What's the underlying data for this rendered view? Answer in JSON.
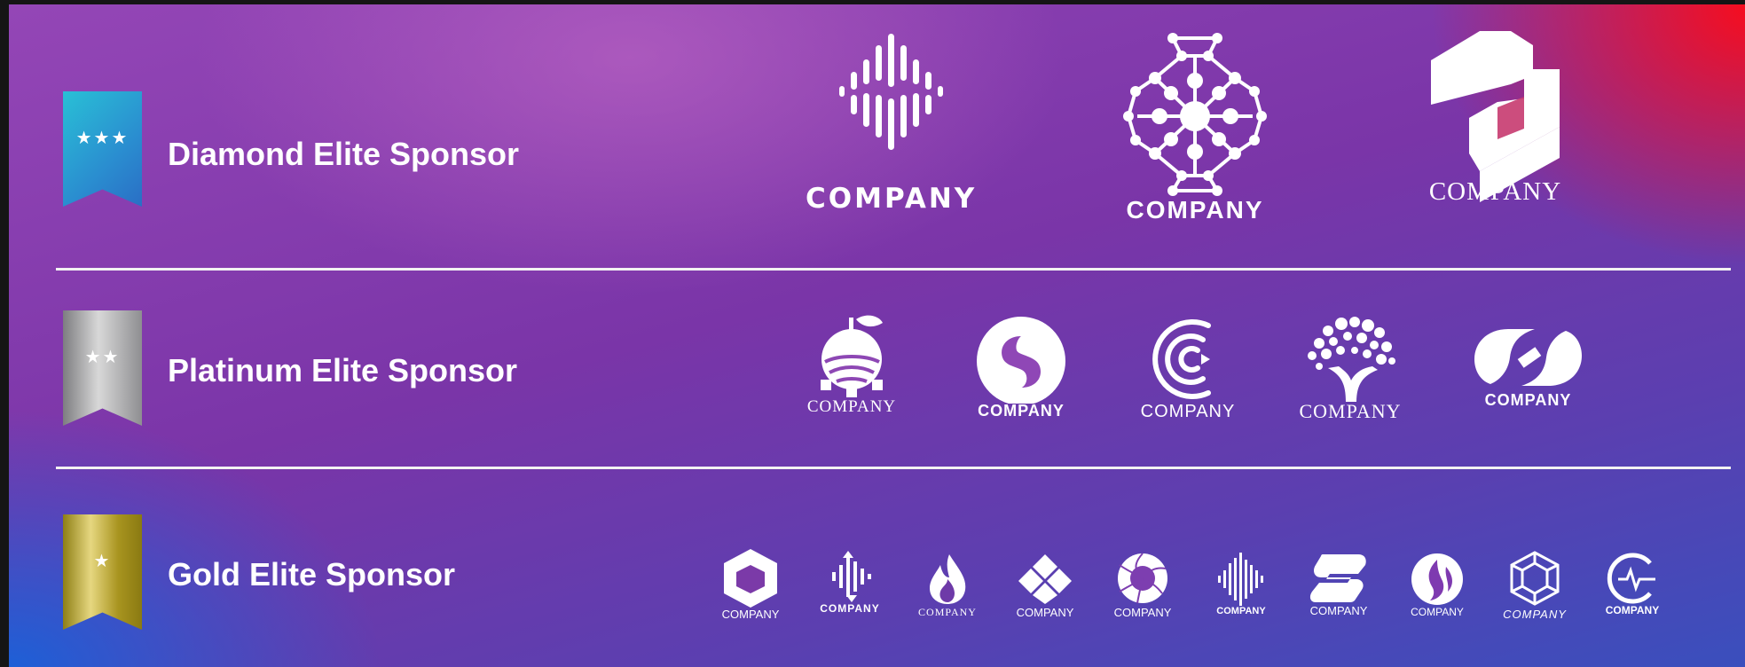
{
  "tiers": [
    {
      "title": "Diamond Elite Sponsor",
      "stars": "★★★",
      "logos": [
        {
          "icon": "sound-wave-diamond-icon",
          "name": "COMPANY"
        },
        {
          "icon": "molecule-network-icon",
          "name": "COMPANY"
        },
        {
          "icon": "hexagon-s-icon",
          "name": "COMPANY"
        }
      ]
    },
    {
      "title": "Platinum Elite Sponsor",
      "stars": "★★",
      "logos": [
        {
          "icon": "fruit-gear-icon",
          "name": "COMPANY"
        },
        {
          "icon": "circle-swirl-icon",
          "name": "COMPANY"
        },
        {
          "icon": "concentric-c-icon",
          "name": "COMPANY"
        },
        {
          "icon": "tree-head-icon",
          "name": "COMPANY"
        },
        {
          "icon": "chain-link-icon",
          "name": "COMPANY"
        }
      ]
    },
    {
      "title": "Gold Elite Sponsor",
      "stars": "★",
      "logos": [
        {
          "icon": "hexagon-cube-icon",
          "name": "COMPANY"
        },
        {
          "icon": "waveform-arrows-icon",
          "name": "COMPANY"
        },
        {
          "icon": "flame-icon",
          "name": "COMPANY"
        },
        {
          "icon": "diamond-tiles-icon",
          "name": "COMPANY"
        },
        {
          "icon": "spiral-ring-icon",
          "name": "COMPANY"
        },
        {
          "icon": "audio-bars-icon",
          "name": "COMPANY"
        },
        {
          "icon": "s-block-icon",
          "name": "COMPANY"
        },
        {
          "icon": "circle-flame-icon",
          "name": "COMPANY"
        },
        {
          "icon": "hexagon-outline-icon",
          "name": "COMPANY"
        },
        {
          "icon": "circle-pulse-icon",
          "name": "COMPANY"
        }
      ]
    }
  ],
  "colors": {
    "ribbon_diamond": "#29a6d3",
    "ribbon_platinum": "#a9a9ab",
    "ribbon_gold": "#c2b03c",
    "text": "#ffffff",
    "background_purple": "#7b36a8",
    "corner_red": "#f20a14"
  }
}
